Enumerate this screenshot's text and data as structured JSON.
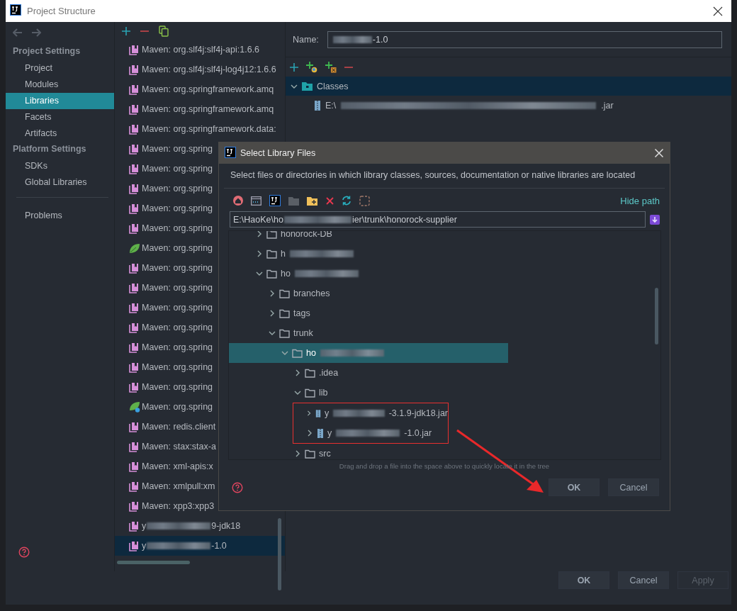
{
  "window": {
    "title": "Project Structure"
  },
  "sidebar": {
    "sections": [
      {
        "header": "Project Settings",
        "items": [
          {
            "label": "Project",
            "selected": false
          },
          {
            "label": "Modules",
            "selected": false
          },
          {
            "label": "Libraries",
            "selected": true
          },
          {
            "label": "Facets",
            "selected": false
          },
          {
            "label": "Artifacts",
            "selected": false
          }
        ]
      },
      {
        "header": "Platform Settings",
        "items": [
          {
            "label": "SDKs",
            "selected": false
          },
          {
            "label": "Global Libraries",
            "selected": false
          }
        ]
      },
      {
        "items": [
          {
            "label": "Problems",
            "selected": false
          }
        ]
      }
    ]
  },
  "libraries": [
    {
      "kind": "library",
      "text": "Maven: org.slf4j:slf4j-api:1.6.6",
      "selected": false
    },
    {
      "kind": "library",
      "text": "Maven: org.slf4j:slf4j-log4j12:1.6.6",
      "selected": false
    },
    {
      "kind": "library",
      "text": "Maven: org.springframework.amq",
      "selected": false
    },
    {
      "kind": "library",
      "text": "Maven: org.springframework.amq",
      "selected": false
    },
    {
      "kind": "library",
      "text": "Maven: org.springframework.data:",
      "selected": false
    },
    {
      "kind": "library",
      "text": "Maven: org.spring",
      "selected": false
    },
    {
      "kind": "library",
      "text": "Maven: org.spring",
      "selected": false
    },
    {
      "kind": "library",
      "text": "Maven: org.spring",
      "selected": false
    },
    {
      "kind": "library",
      "text": "Maven: org.spring",
      "selected": false
    },
    {
      "kind": "library",
      "text": "Maven: org.spring",
      "selected": false
    },
    {
      "kind": "spring",
      "text": "Maven: org.spring",
      "selected": false
    },
    {
      "kind": "library",
      "text": "Maven: org.spring",
      "selected": false
    },
    {
      "kind": "library",
      "text": "Maven: org.spring",
      "selected": false
    },
    {
      "kind": "library",
      "text": "Maven: org.spring",
      "selected": false
    },
    {
      "kind": "library",
      "text": "Maven: org.spring",
      "selected": false
    },
    {
      "kind": "library",
      "text": "Maven: org.spring",
      "selected": false
    },
    {
      "kind": "library",
      "text": "Maven: org.spring",
      "selected": false
    },
    {
      "kind": "library",
      "text": "Maven: org.spring",
      "selected": false
    },
    {
      "kind": "spring-boot",
      "text": "Maven: org.spring",
      "selected": false
    },
    {
      "kind": "library",
      "text": "Maven: redis.client",
      "selected": false
    },
    {
      "kind": "library",
      "text": "Maven: stax:stax-a",
      "selected": false
    },
    {
      "kind": "library",
      "text": "Maven: xml-apis:x",
      "selected": false
    },
    {
      "kind": "library",
      "text": "Maven: xmlpull:xm",
      "selected": false
    },
    {
      "kind": "library",
      "text": "Maven: xpp3:xpp3",
      "selected": false
    },
    {
      "kind": "library",
      "lead": "y",
      "blurred": true,
      "tail": "9-jdk18",
      "selected": false
    },
    {
      "kind": "library",
      "lead": "y",
      "blurred": true,
      "tail": "-1.0",
      "selected": true
    }
  ],
  "detail": {
    "name_label": "Name:",
    "name_value": {
      "blurred": true,
      "tail": "-1.0"
    },
    "roots": [
      {
        "label": "Classes",
        "expanded": true,
        "children": [
          {
            "lead": "E:\\",
            "blurred": true,
            "tail": ".jar"
          }
        ]
      }
    ]
  },
  "footer": {
    "buttons": [
      {
        "label": "OK",
        "disabled": false,
        "default": true
      },
      {
        "label": "Cancel",
        "disabled": false,
        "default": false
      },
      {
        "label": "Apply",
        "disabled": true,
        "default": false
      }
    ]
  },
  "dialog": {
    "title": "Select Library Files",
    "description": "Select files or directories in which library classes, sources, documentation or native libraries are located",
    "hide_path": "Hide path",
    "path": {
      "lead": "E:\\HaoKe\\ho",
      "blurred": true,
      "tail": "ier\\trunk\\honorock-supplier"
    },
    "tree": [
      {
        "kind": "folder",
        "text": "honorock-DB",
        "expanded": false,
        "selected": false
      },
      {
        "kind": "folder",
        "lead": "h",
        "blurred": true,
        "expanded": false,
        "selected": false
      },
      {
        "kind": "folder",
        "lead": "ho",
        "blurred": true,
        "expanded": true,
        "selected": false,
        "children": [
          {
            "kind": "folder",
            "text": "branches",
            "expanded": false,
            "selected": false
          },
          {
            "kind": "folder",
            "text": "tags",
            "expanded": false,
            "selected": false
          },
          {
            "kind": "folder",
            "text": "trunk",
            "expanded": true,
            "selected": false,
            "children": [
              {
                "kind": "folder",
                "lead": "ho",
                "blurred": true,
                "expanded": true,
                "selected": true,
                "children": [
                  {
                    "kind": "folder",
                    "text": ".idea",
                    "expanded": false,
                    "selected": false
                  },
                  {
                    "kind": "folder",
                    "text": "lib",
                    "expanded": true,
                    "selected": false,
                    "children_highlighted": true,
                    "children": [
                      {
                        "kind": "jar",
                        "lead": "y",
                        "blurred": true,
                        "tail": "-3.1.9-jdk18.jar",
                        "expanded": false,
                        "selected": false
                      },
                      {
                        "kind": "jar",
                        "lead": "y",
                        "blurred": true,
                        "tail": "-1.0.jar",
                        "expanded": false,
                        "selected": false
                      }
                    ]
                  },
                  {
                    "kind": "folder",
                    "text": "src",
                    "expanded": false,
                    "selected": false
                  }
                ]
              }
            ]
          }
        ]
      }
    ],
    "hint": "Drag and drop a file into the space above to quickly locate it in the tree",
    "buttons": [
      {
        "label": "OK",
        "default": true
      },
      {
        "label": "Cancel",
        "default": false
      }
    ]
  }
}
